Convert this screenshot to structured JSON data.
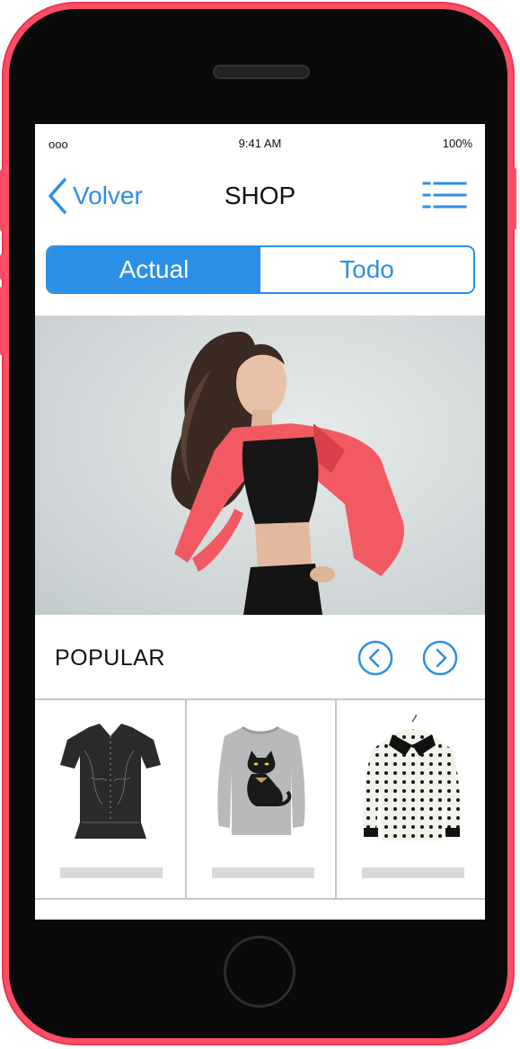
{
  "status_bar": {
    "carrier": "ooo",
    "time": "9:41 AM",
    "battery": "100%"
  },
  "nav": {
    "back_label": "Volver",
    "title": "SHOP",
    "back_icon": "chevron-left-icon",
    "menu_icon": "list-menu-icon"
  },
  "segments": {
    "items": [
      {
        "label": "Actual",
        "active": true
      },
      {
        "label": "Todo",
        "active": false
      }
    ]
  },
  "hero": {
    "image": "model-in-red-blazer-photo"
  },
  "popular": {
    "title": "POPULAR",
    "prev_icon": "circle-chevron-left-icon",
    "next_icon": "circle-chevron-right-icon"
  },
  "products": [
    {
      "image": "black-lace-blouse-image"
    },
    {
      "image": "grey-cat-sweater-image"
    },
    {
      "image": "polka-dot-collar-blouse-image"
    }
  ],
  "colors": {
    "accent": "#2b8fe6",
    "frame": "#ff4d66",
    "divider": "#c8c8c8"
  }
}
